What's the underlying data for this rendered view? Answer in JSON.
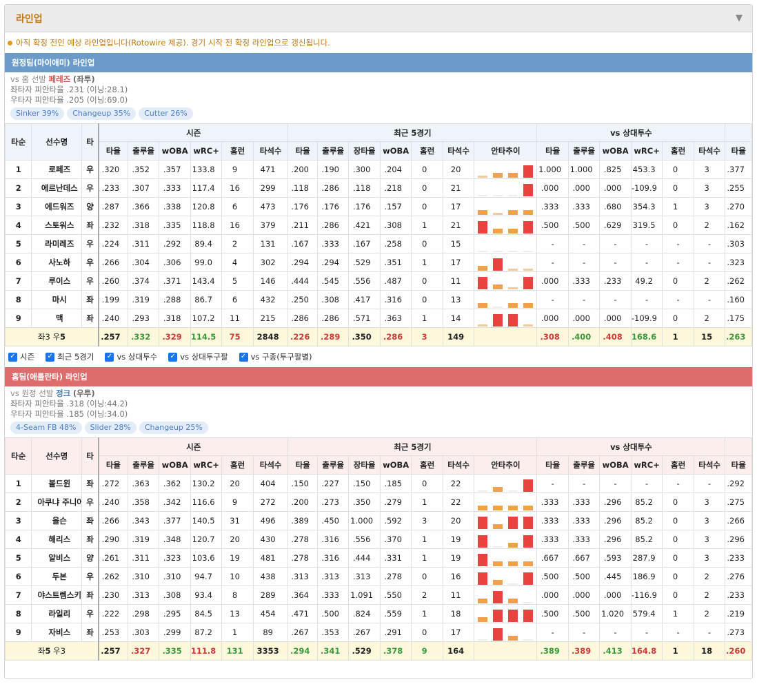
{
  "panel": {
    "title": "라인업",
    "toggle_icon": "▼"
  },
  "notice": "아직 확정 전인 예상 라인업입니다(Rotowire 제공). 경기 시작 전 확정 라인업으로 갱신됩니다.",
  "headers": {
    "order": "타순",
    "name": "선수명",
    "bats": "타",
    "season": "시즌",
    "recent": "최근 5경기",
    "vsp": "vs 상대투수",
    "cols_season": [
      "타율",
      "출루율",
      "wOBA",
      "wRC+",
      "홈런",
      "타석수"
    ],
    "cols_recent": [
      "타율",
      "출루율",
      "장타율",
      "wOBA",
      "홈런",
      "타석수",
      "안타추이"
    ],
    "cols_vsp": [
      "타율",
      "출루율",
      "wOBA",
      "wRC+",
      "홈런",
      "타석수"
    ],
    "col_extra": "타율"
  },
  "away": {
    "bar": "원정팀(마이애미) 라인업",
    "vs_prefix": "vs 홈 선발 ",
    "pitcher": "페레즈",
    "hand": "(좌투)",
    "split_l": "좌타자 피안타율 .231 (이닝:28.1)",
    "split_r": "우타자 피안타율 .205 (이닝:69.0)",
    "pitches": [
      "Sinker 39%",
      "Changeup 35%",
      "Cutter 26%"
    ],
    "rows": [
      [
        "1",
        "로페즈",
        "우",
        ".320",
        ".352",
        ".357",
        "133.8",
        "9",
        "471",
        ".200",
        ".190",
        ".300",
        ".204",
        "0",
        "20",
        [
          0,
          1,
          1,
          3
        ],
        "1.000",
        "1.000",
        ".825",
        "453.3",
        "0",
        "3",
        ".377"
      ],
      [
        "2",
        "에르난데스",
        "우",
        ".233",
        ".307",
        ".333",
        "117.4",
        "16",
        "299",
        ".118",
        ".286",
        ".118",
        ".218",
        "0",
        "21",
        [
          -1,
          -1,
          -1,
          3
        ],
        ".000",
        ".000",
        ".000",
        "-109.9",
        "0",
        "3",
        ".255"
      ],
      [
        "3",
        "에드워즈",
        "양",
        ".287",
        ".366",
        ".338",
        "120.8",
        "6",
        "473",
        ".176",
        ".176",
        ".176",
        ".157",
        "0",
        "17",
        [
          1,
          0,
          1,
          1
        ],
        ".333",
        ".333",
        ".680",
        "354.3",
        "1",
        "3",
        ".270"
      ],
      [
        "4",
        "스토워스",
        "좌",
        ".232",
        ".318",
        ".335",
        "118.8",
        "16",
        "379",
        ".211",
        ".286",
        ".421",
        ".308",
        "1",
        "21",
        [
          3,
          1,
          1,
          3
        ],
        ".500",
        ".500",
        ".629",
        "319.5",
        "0",
        "2",
        ".162"
      ],
      [
        "5",
        "라미레즈",
        "우",
        ".224",
        ".311",
        ".292",
        "89.4",
        "2",
        "131",
        ".167",
        ".333",
        ".167",
        ".258",
        "0",
        "15",
        [
          -1,
          -1,
          -1,
          -1
        ],
        "-",
        "-",
        "-",
        "-",
        "-",
        "-",
        ".303"
      ],
      [
        "6",
        "사노하",
        "우",
        ".266",
        ".304",
        ".306",
        "99.0",
        "4",
        "302",
        ".294",
        ".294",
        ".529",
        ".351",
        "1",
        "17",
        [
          1,
          3,
          0,
          0
        ],
        "-",
        "-",
        "-",
        "-",
        "-",
        "-",
        ".323"
      ],
      [
        "7",
        "루이스",
        "우",
        ".260",
        ".374",
        ".371",
        "143.4",
        "5",
        "146",
        ".444",
        ".545",
        ".556",
        ".487",
        "0",
        "11",
        [
          3,
          1,
          0,
          3
        ],
        ".000",
        ".333",
        ".233",
        "49.2",
        "0",
        "2",
        ".262"
      ],
      [
        "8",
        "마시",
        "좌",
        ".199",
        ".319",
        ".288",
        "86.7",
        "6",
        "432",
        ".250",
        ".308",
        ".417",
        ".316",
        "0",
        "13",
        [
          1,
          -1,
          1,
          1
        ],
        "-",
        "-",
        "-",
        "-",
        "-",
        "-",
        ".160"
      ],
      [
        "9",
        "맥",
        "좌",
        ".240",
        ".293",
        ".318",
        "107.2",
        "11",
        "215",
        ".286",
        ".286",
        ".571",
        ".363",
        "1",
        "14",
        [
          0,
          3,
          3,
          0
        ],
        ".000",
        ".000",
        ".000",
        "-109.9",
        "0",
        "2",
        ".175"
      ]
    ],
    "total": {
      "label_a": "좌3 우",
      "label_b": "5",
      "vals": [
        ".257",
        ".332",
        ".329",
        "114.5",
        "75",
        "2848",
        ".226",
        ".289",
        ".350",
        ".286",
        "3",
        "149",
        "",
        ".308",
        ".400",
        ".408",
        "168.6",
        "1",
        "15",
        ".263"
      ],
      "colors": [
        "blk",
        "green",
        "red",
        "green",
        "red",
        "blk",
        "red",
        "red",
        "blk",
        "red",
        "red",
        "blk",
        "blk",
        "red",
        "green",
        "red",
        "green",
        "blk",
        "blk",
        "green"
      ]
    }
  },
  "checks": [
    "시즌",
    "최근 5경기",
    "vs 상대투수",
    "vs 상대투구팔",
    "vs 구종(투구팔별)"
  ],
  "home": {
    "bar": "홈팀(애틀란타) 라인업",
    "vs_prefix": "vs 원정 선발 ",
    "pitcher": "정크",
    "hand": "(우투)",
    "split_l": "좌타자 피안타율 .318 (이닝:44.2)",
    "split_r": "우타자 피안타율 .185 (이닝:34.0)",
    "pitches": [
      "4-Seam FB 48%",
      "Slider 28%",
      "Changeup 25%"
    ],
    "rows": [
      [
        "1",
        "볼드윈",
        "좌",
        ".272",
        ".363",
        ".362",
        "130.2",
        "20",
        "404",
        ".150",
        ".227",
        ".150",
        ".185",
        "0",
        "22",
        [
          -1,
          1,
          -1,
          3
        ],
        "-",
        "-",
        "-",
        "-",
        "-",
        "-",
        ".292"
      ],
      [
        "2",
        "아쿠냐 주니어",
        "우",
        ".240",
        ".358",
        ".342",
        "116.6",
        "9",
        "272",
        ".200",
        ".273",
        ".350",
        ".279",
        "1",
        "22",
        [
          1,
          1,
          1,
          1
        ],
        ".333",
        ".333",
        ".296",
        "85.2",
        "0",
        "3",
        ".275"
      ],
      [
        "3",
        "올슨",
        "좌",
        ".266",
        ".343",
        ".377",
        "140.5",
        "31",
        "496",
        ".389",
        ".450",
        "1.000",
        ".592",
        "3",
        "20",
        [
          3,
          1,
          3,
          3
        ],
        ".333",
        ".333",
        ".296",
        "85.2",
        "0",
        "3",
        ".266"
      ],
      [
        "4",
        "해리스",
        "좌",
        ".290",
        ".319",
        ".348",
        "120.7",
        "20",
        "430",
        ".278",
        ".316",
        ".556",
        ".370",
        "1",
        "19",
        [
          3,
          -1,
          1,
          3
        ],
        ".333",
        ".333",
        ".296",
        "85.2",
        "0",
        "3",
        ".296"
      ],
      [
        "5",
        "알비스",
        "양",
        ".261",
        ".311",
        ".323",
        "103.6",
        "19",
        "481",
        ".278",
        ".316",
        ".444",
        ".331",
        "1",
        "19",
        [
          3,
          1,
          1,
          1
        ],
        ".667",
        ".667",
        ".593",
        "287.9",
        "0",
        "3",
        ".233"
      ],
      [
        "6",
        "두본",
        "우",
        ".262",
        ".310",
        ".310",
        "94.7",
        "10",
        "438",
        ".313",
        ".313",
        ".313",
        ".278",
        "0",
        "16",
        [
          3,
          1,
          -1,
          3
        ],
        ".500",
        ".500",
        ".445",
        "186.9",
        "0",
        "2",
        ".276"
      ],
      [
        "7",
        "야스트렘스키",
        "좌",
        ".230",
        ".313",
        ".308",
        "93.4",
        "8",
        "289",
        ".364",
        ".333",
        "1.091",
        ".550",
        "2",
        "11",
        [
          1,
          3,
          1,
          -1
        ],
        ".000",
        ".000",
        ".000",
        "-116.9",
        "0",
        "2",
        ".233"
      ],
      [
        "8",
        "라일리",
        "우",
        ".222",
        ".298",
        ".295",
        "84.5",
        "13",
        "454",
        ".471",
        ".500",
        ".824",
        ".559",
        "1",
        "18",
        [
          1,
          3,
          3,
          3
        ],
        ".500",
        ".500",
        "1.020",
        "579.4",
        "1",
        "2",
        ".219"
      ],
      [
        "9",
        "자비스",
        "좌",
        ".253",
        ".303",
        ".299",
        "87.2",
        "1",
        "89",
        ".267",
        ".353",
        ".267",
        ".291",
        "0",
        "17",
        [
          -1,
          3,
          1,
          -1
        ],
        "-",
        "-",
        "-",
        "-",
        "-",
        "-",
        ".273"
      ]
    ],
    "total": {
      "label_a": "좌",
      "label_b": "5",
      "label_c": " 우3",
      "vals": [
        ".257",
        ".327",
        ".335",
        "111.8",
        "131",
        "3353",
        ".294",
        ".341",
        ".529",
        ".378",
        "9",
        "164",
        "",
        ".389",
        ".389",
        ".413",
        "164.8",
        "1",
        "18",
        ".260"
      ],
      "colors": [
        "blk",
        "red",
        "green",
        "red",
        "green",
        "blk",
        "green",
        "green",
        "blk",
        "green",
        "green",
        "blk",
        "blk",
        "green",
        "red",
        "green",
        "red",
        "blk",
        "blk",
        "red"
      ]
    }
  }
}
